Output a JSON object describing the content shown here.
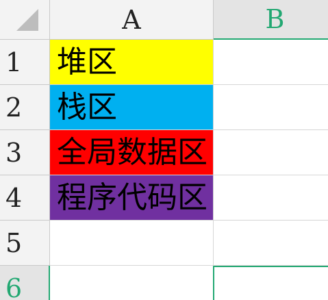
{
  "sheet": {
    "columns": [
      {
        "label": "A"
      },
      {
        "label": "B",
        "selected": true
      }
    ],
    "rows": [
      {
        "label": "1",
        "a": {
          "text": "堆区",
          "fill": "#FFFF00"
        }
      },
      {
        "label": "2",
        "a": {
          "text": "栈区",
          "fill": "#00B0F0"
        }
      },
      {
        "label": "3",
        "a": {
          "text": "全局数据区",
          "fill": "#FF0000"
        }
      },
      {
        "label": "4",
        "a": {
          "text": "程序代码区",
          "fill": "#7030A0"
        }
      },
      {
        "label": "5",
        "a": {
          "text": "",
          "fill": ""
        }
      },
      {
        "label": "6",
        "a": {
          "text": "",
          "fill": ""
        },
        "selected": true
      }
    ],
    "accent": "#22A872"
  }
}
